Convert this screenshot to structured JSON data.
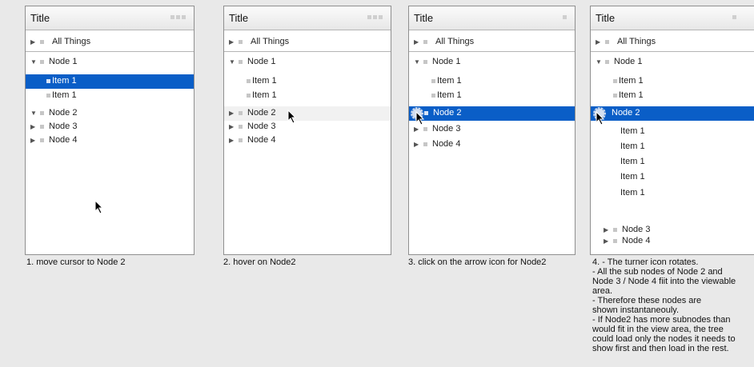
{
  "panels": [
    {
      "title": "Title",
      "header": "All Things",
      "rows": [
        "Node 1",
        "Item 1",
        "Item 1",
        "Node 2",
        "Node 3",
        "Node 4"
      ],
      "caption": "1. move cursor to Node 2"
    },
    {
      "title": "Title",
      "header": "All Things",
      "rows": [
        "Node 1",
        "Item 1",
        "Item 1",
        "Node 2",
        "Node 3",
        "Node 4"
      ],
      "caption": "2. hover on Node2"
    },
    {
      "title": "Title",
      "header": "All Things",
      "rows": [
        "Node 1",
        "Item 1",
        "Item 1",
        "Node 2",
        "Node 3",
        "Node 4"
      ],
      "caption": "3. click on the arrow icon for Node2"
    },
    {
      "title": "Title",
      "header": "All Things",
      "rows": [
        "Node 1",
        "Item 1",
        "Item 1",
        "Node 2",
        "Item 1",
        "Item 1",
        "Item 1",
        "Item 1",
        "Item 1",
        "Node 3",
        "Node 4"
      ],
      "caption": "4. - The turner icon rotates.\n      - All the sub nodes of Node 2 and\nNode 3 / Node 4 fiit into the viewable\narea.\n      - Therefore these nodes are\nshown instantaneouly.\n- If Node2 has more subnodes than\nwould fit in the view area, the tree\ncould load only the nodes it needs to\nshow first and then load in the rest."
    }
  ],
  "colors": {
    "selection": "#0a5ec7",
    "hover": "#f1f1f1",
    "border": "#8f8f8f"
  }
}
